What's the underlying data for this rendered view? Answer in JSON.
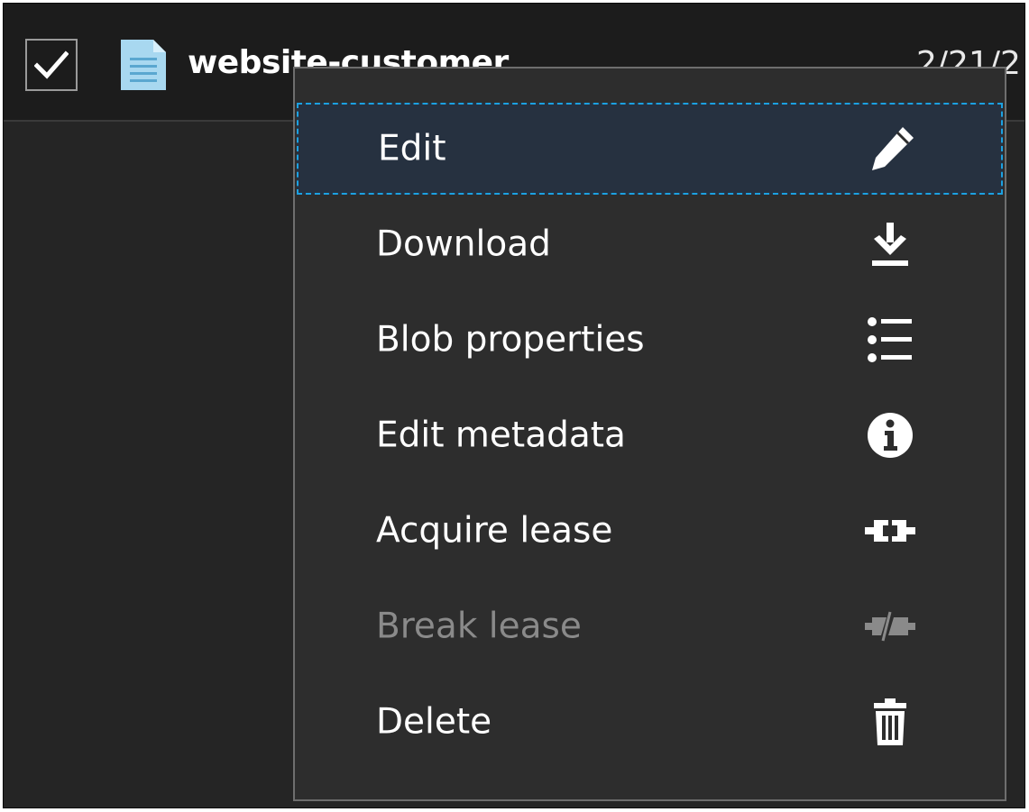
{
  "file_row": {
    "checked": true,
    "name": "website-customer",
    "date": "2/21/2"
  },
  "context_menu": {
    "focused_item": "Edit",
    "items": [
      {
        "label": "Edit",
        "icon": "pencil-icon",
        "enabled": true
      },
      {
        "label": "Download",
        "icon": "download-icon",
        "enabled": true
      },
      {
        "label": "Blob properties",
        "icon": "list-icon",
        "enabled": true
      },
      {
        "label": "Edit metadata",
        "icon": "info-icon",
        "enabled": true
      },
      {
        "label": "Acquire lease",
        "icon": "plug-connected-icon",
        "enabled": true
      },
      {
        "label": "Break lease",
        "icon": "plug-broken-icon",
        "enabled": false
      },
      {
        "label": "Delete",
        "icon": "trash-icon",
        "enabled": true
      }
    ]
  },
  "colors": {
    "background": "#252525",
    "menu_background": "#2d2d2d",
    "focus_outline": "#1ba1e2",
    "focus_fill": "#263140",
    "text": "#ffffff",
    "disabled_text": "#8a8a8a",
    "file_icon": "#a8d8f0"
  }
}
